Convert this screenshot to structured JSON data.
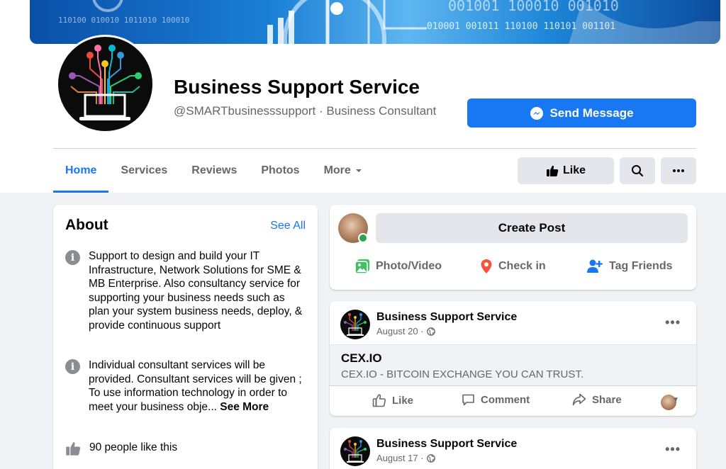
{
  "header": {
    "cover_binary": [
      "110100 010010 1011010 100010",
      "010001 001011 110100 110101 001101",
      "001001 100010 001010"
    ],
    "page_name": "Business Support Service",
    "page_subtitle": "@SMARTbusinesssupport · Business Consultant",
    "send_message_label": "Send Message"
  },
  "tabs": [
    {
      "label": "Home",
      "active": true
    },
    {
      "label": "Services"
    },
    {
      "label": "Reviews"
    },
    {
      "label": "Photos"
    },
    {
      "label": "More"
    }
  ],
  "actions": {
    "like_label": "Like"
  },
  "about": {
    "title": "About",
    "see_all": "See All",
    "description": "Support to design and build your IT Infrastructure, Network Solutions for SME & MB Enterprise. Also consultancy service for supporting your business needs such as plan your system business needs, deploy, & provide continuous support",
    "individual": "Individual consultant services will be provided. Consultant services will be given ; To use information technology in order to meet your business obje...",
    "see_more": "See More",
    "likes": "90 people like this"
  },
  "create_post": {
    "button": "Create Post",
    "photo_video": "Photo/Video",
    "check_in": "Check in",
    "tag_friends": "Tag Friends"
  },
  "posts": [
    {
      "author": "Business Support Service",
      "date": "August 20 ·",
      "link_title": "CEX.IO",
      "link_desc": "CEX.IO - BITCOIN EXCHANGE YOU CAN TRUST.",
      "like": "Like",
      "comment": "Comment",
      "share": "Share"
    },
    {
      "author": "Business Support Service",
      "date": "August 17 ·"
    }
  ],
  "colors": {
    "accent": "#1877f2",
    "online": "#31a24c",
    "muted_text": "#65676b",
    "button_gray": "#e4e6eb"
  }
}
